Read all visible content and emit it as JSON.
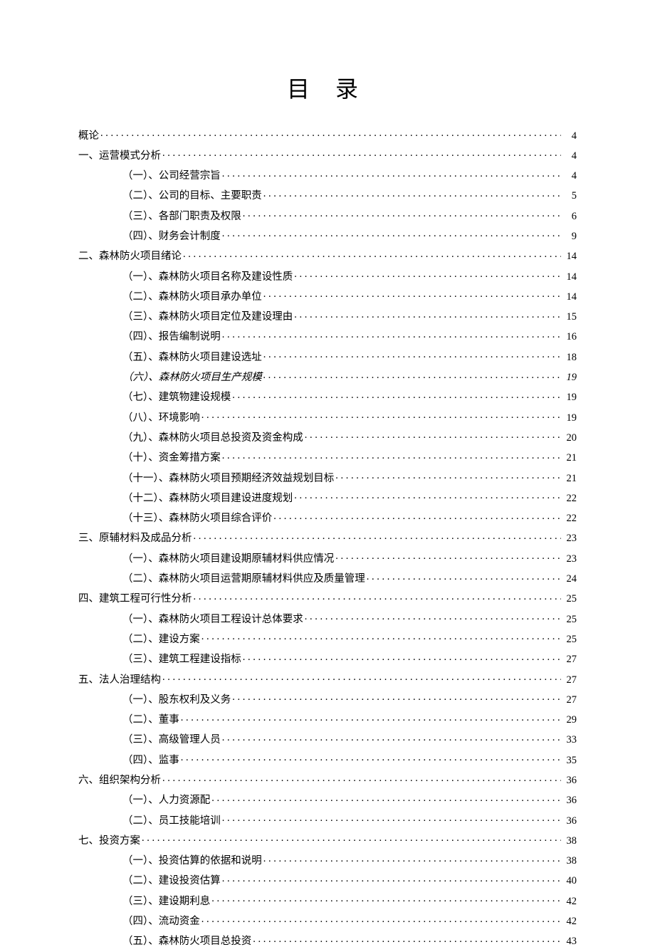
{
  "title": "目 录",
  "toc": [
    {
      "label": "概论",
      "page": "4",
      "level": 0
    },
    {
      "label": "一、运营模式分析",
      "page": "4",
      "level": 0
    },
    {
      "label": "（一）、公司经营宗旨",
      "page": "4",
      "level": 1
    },
    {
      "label": "（二）、公司的目标、主要职责",
      "page": "5",
      "level": 1
    },
    {
      "label": "（三）、各部门职责及权限",
      "page": "6",
      "level": 1
    },
    {
      "label": "（四）、财务会计制度",
      "page": "9",
      "level": 1
    },
    {
      "label": "二、森林防火项目绪论",
      "page": "14",
      "level": 0
    },
    {
      "label": "（一）、森林防火项目名称及建设性质",
      "page": "14",
      "level": 1
    },
    {
      "label": "（二）、森林防火项目承办单位",
      "page": "14",
      "level": 1
    },
    {
      "label": "（三）、森林防火项目定位及建设理由",
      "page": "15",
      "level": 1
    },
    {
      "label": "（四）、报告编制说明",
      "page": "16",
      "level": 1
    },
    {
      "label": "（五）、森林防火项目建设选址",
      "page": "18",
      "level": 1
    },
    {
      "label": "（六）、森林防火项目生产规模",
      "page": "19",
      "level": 1,
      "italic": true
    },
    {
      "label": "（七）、建筑物建设规模",
      "page": "19",
      "level": 1
    },
    {
      "label": "（八）、环境影响",
      "page": "19",
      "level": 1
    },
    {
      "label": "（九）、森林防火项目总投资及资金构成",
      "page": "20",
      "level": 1
    },
    {
      "label": "（十）、资金筹措方案",
      "page": "21",
      "level": 1
    },
    {
      "label": "（十一）、森林防火项目预期经济效益规划目标",
      "page": "21",
      "level": 1
    },
    {
      "label": "（十二）、森林防火项目建设进度规划",
      "page": "22",
      "level": 1
    },
    {
      "label": "（十三）、森林防火项目综合评价",
      "page": "22",
      "level": 1
    },
    {
      "label": "三、原辅材料及成品分析",
      "page": "23",
      "level": 0
    },
    {
      "label": "（一）、森林防火项目建设期原辅材料供应情况",
      "page": "23",
      "level": 1
    },
    {
      "label": "（二）、森林防火项目运营期原辅材料供应及质量管理",
      "page": "24",
      "level": 1
    },
    {
      "label": "四、建筑工程可行性分析",
      "page": "25",
      "level": 0
    },
    {
      "label": "（一）、森林防火项目工程设计总体要求",
      "page": "25",
      "level": 1
    },
    {
      "label": "（二）、建设方案",
      "page": "25",
      "level": 1
    },
    {
      "label": "（三）、建筑工程建设指标",
      "page": "27",
      "level": 1
    },
    {
      "label": "五、法人治理结构",
      "page": "27",
      "level": 0
    },
    {
      "label": "（一）、股东权利及义务",
      "page": "27",
      "level": 1
    },
    {
      "label": "（二）、董事",
      "page": "29",
      "level": 1
    },
    {
      "label": "（三）、高级管理人员",
      "page": "33",
      "level": 1
    },
    {
      "label": "（四）、监事",
      "page": "35",
      "level": 1
    },
    {
      "label": "六、组织架构分析",
      "page": "36",
      "level": 0
    },
    {
      "label": "（一）、人力资源配",
      "page": "36",
      "level": 1
    },
    {
      "label": "（二）、员工技能培训",
      "page": "36",
      "level": 1
    },
    {
      "label": "七、投资方案",
      "page": "38",
      "level": 0
    },
    {
      "label": "（一）、投资估算的依据和说明",
      "page": "38",
      "level": 1
    },
    {
      "label": "（二）、建设投资估算",
      "page": "40",
      "level": 1
    },
    {
      "label": "（三）、建设期利息",
      "page": "42",
      "level": 1
    },
    {
      "label": "（四）、流动资金",
      "page": "42",
      "level": 1
    },
    {
      "label": "（五）、森林防火项目总投资",
      "page": "43",
      "level": 1
    }
  ]
}
